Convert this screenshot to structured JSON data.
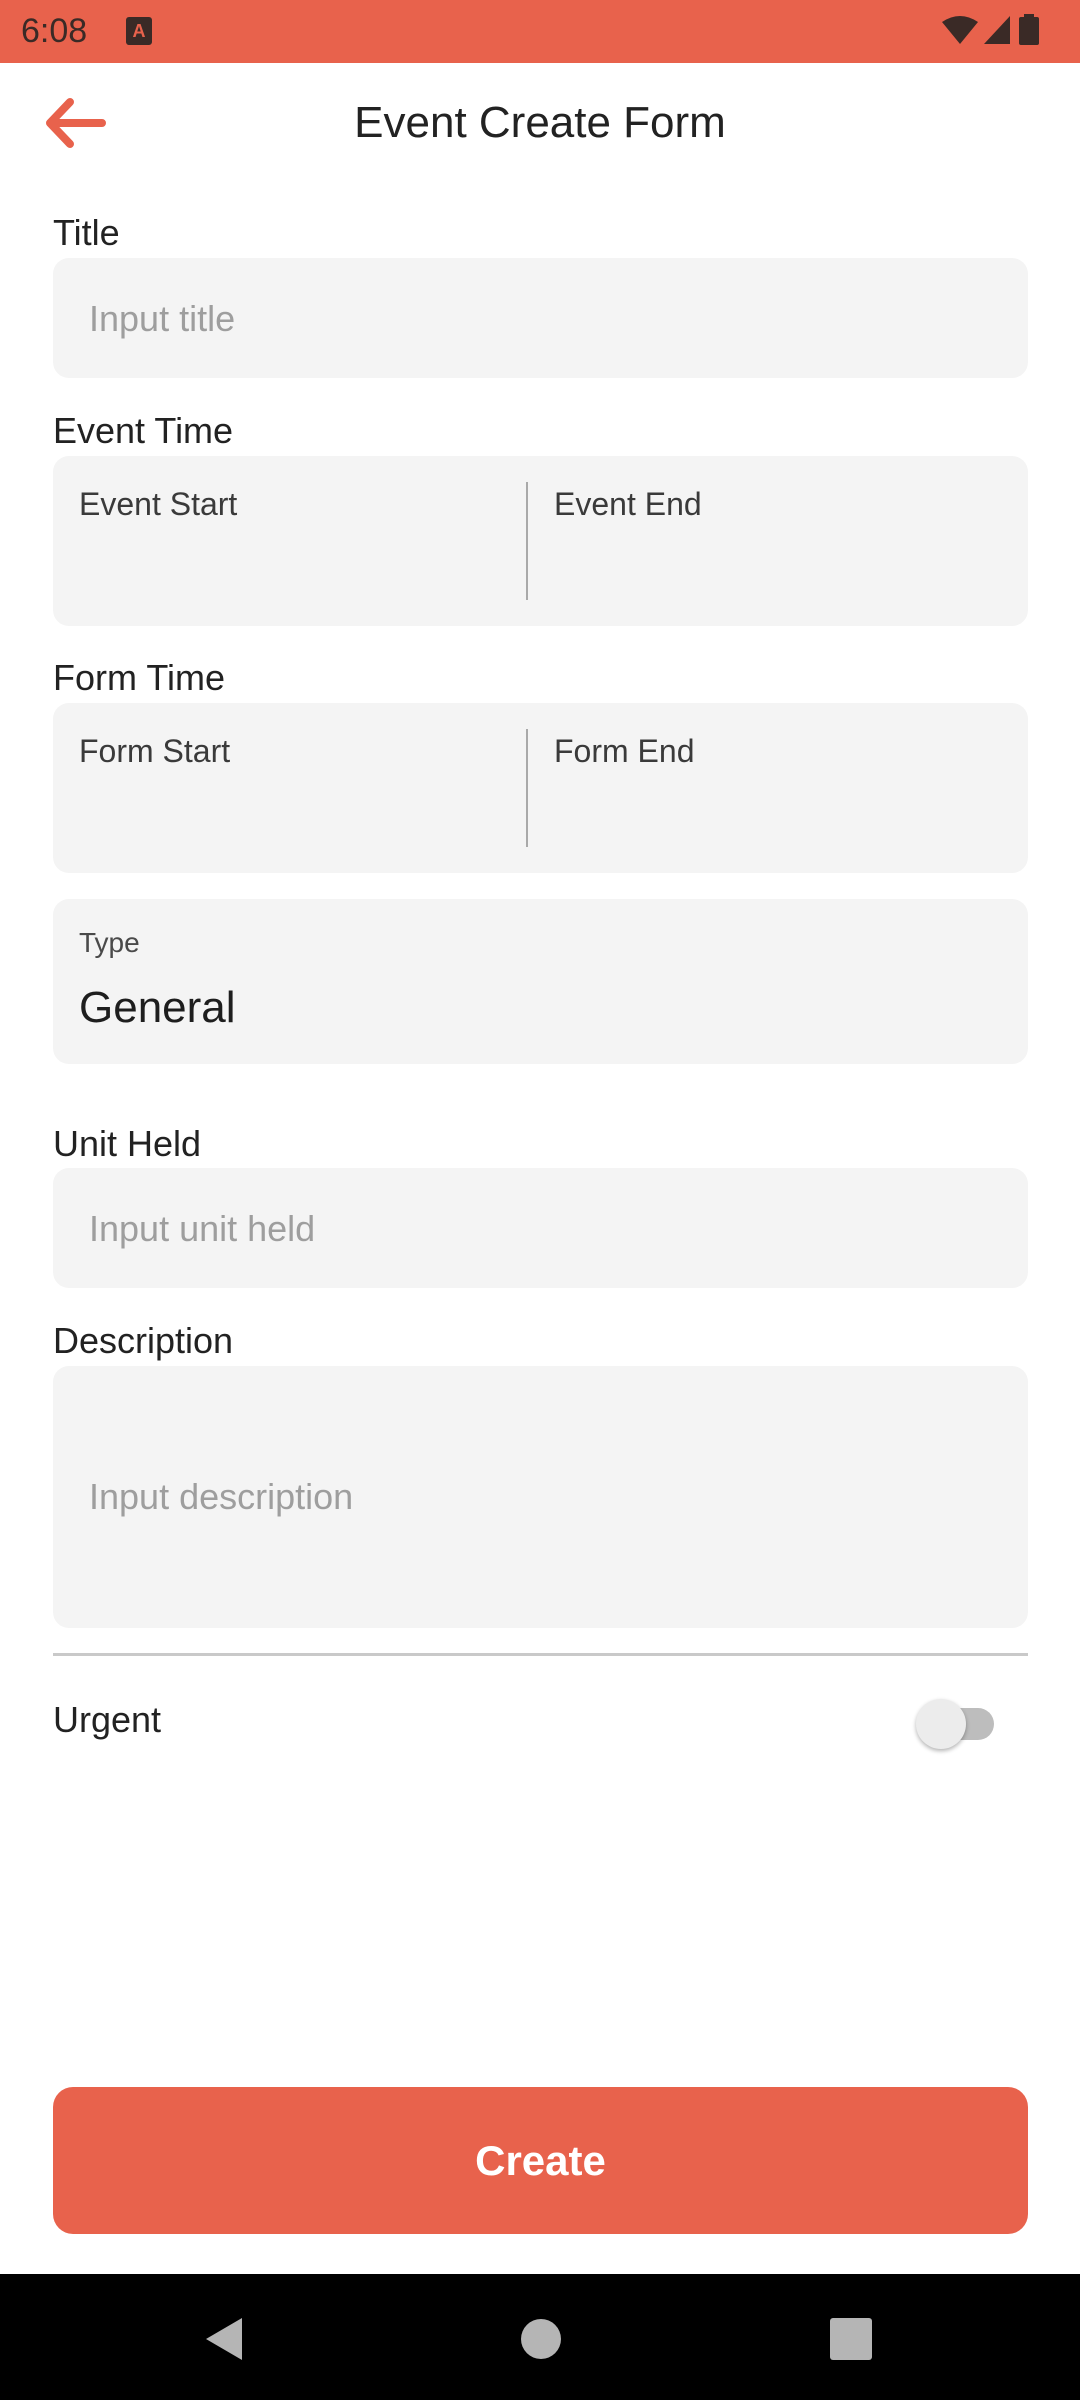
{
  "status_bar": {
    "time": "6:08",
    "app_icon_letter": "A",
    "color": "#e8624c",
    "icons": [
      "wifi-icon",
      "signal-icon",
      "battery-icon"
    ]
  },
  "header": {
    "title": "Event Create Form",
    "back_icon": "arrow-left-icon",
    "accent_color": "#e8624c"
  },
  "form": {
    "title_section": {
      "label": "Title",
      "placeholder": "Input title"
    },
    "event_time": {
      "label": "Event Time",
      "start_label": "Event Start",
      "end_label": "Event End"
    },
    "form_time": {
      "label": "Form Time",
      "start_label": "Form Start",
      "end_label": "Form End"
    },
    "type": {
      "label": "Type",
      "value": "General"
    },
    "unit_held": {
      "label": "Unit Held",
      "placeholder": "Input unit held"
    },
    "description": {
      "label": "Description",
      "placeholder": "Input description"
    },
    "urgent": {
      "label": "Urgent",
      "enabled": false
    }
  },
  "actions": {
    "create_label": "Create"
  },
  "nav_bar": {
    "icons": [
      "back-triangle-icon",
      "home-circle-icon",
      "recents-square-icon"
    ]
  }
}
